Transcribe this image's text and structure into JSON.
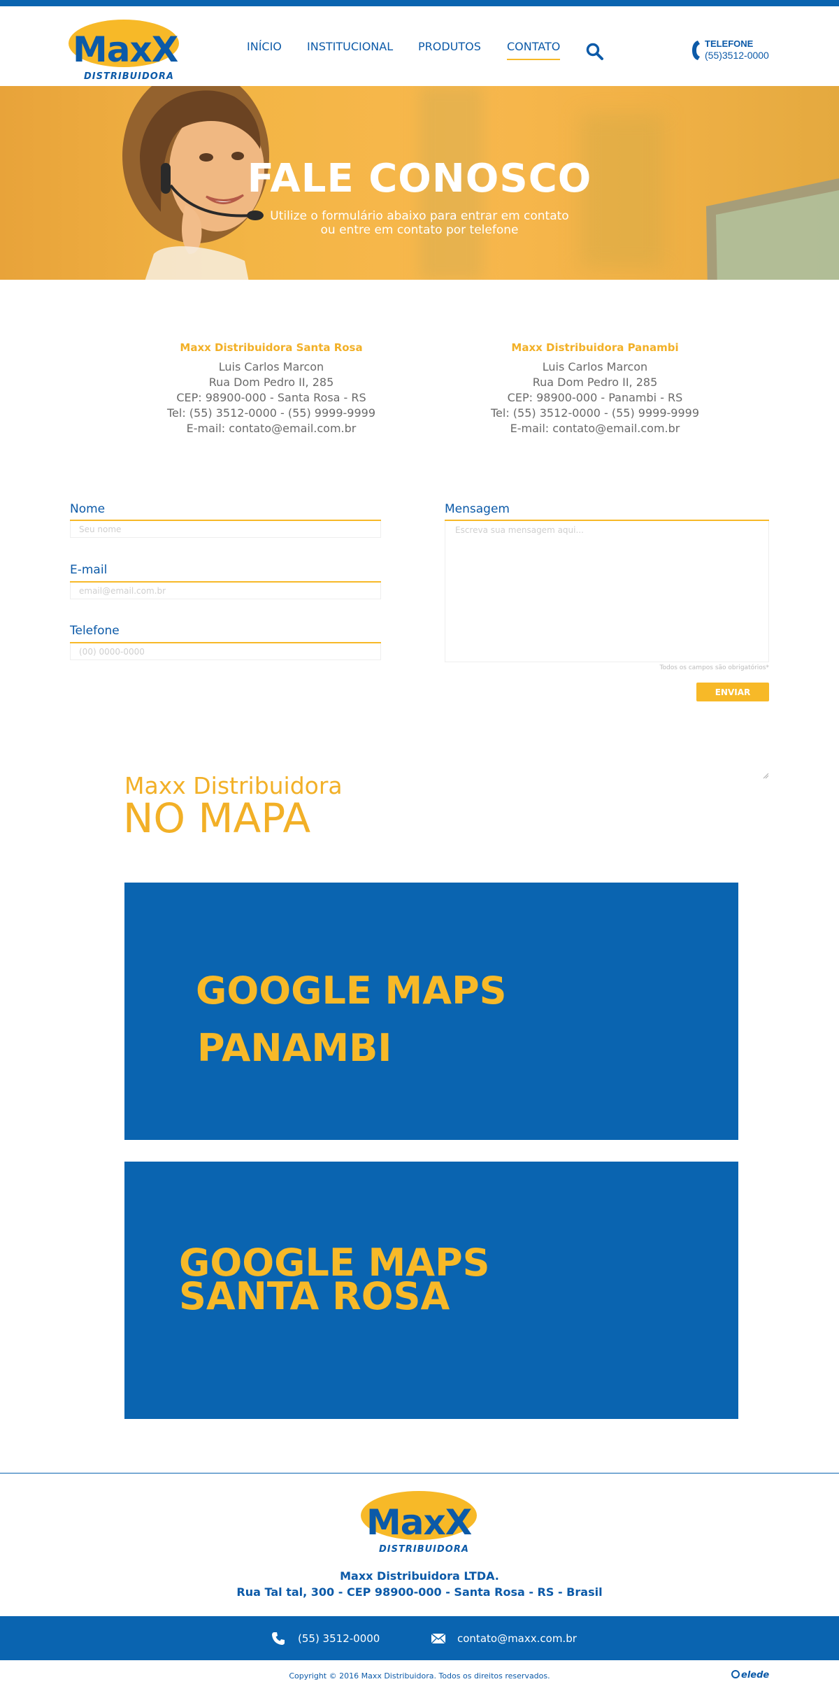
{
  "brand": {
    "logo_text": "MaxX",
    "logo_sub": "DISTRIBUIDORA",
    "colors": {
      "blue": "#0a64b0",
      "yellow": "#f7b928"
    }
  },
  "nav": {
    "items": [
      {
        "label": "INÍCIO",
        "active": false
      },
      {
        "label": "INSTITUCIONAL",
        "active": false
      },
      {
        "label": "PRODUTOS",
        "active": false
      },
      {
        "label": "CONTATO",
        "active": true
      }
    ],
    "search_icon": "search-icon"
  },
  "header_phone": {
    "label": "TELEFONE",
    "number": "(55)3512-0000",
    "icon": "phone-icon"
  },
  "hero": {
    "title": "FALE CONOSCO",
    "subtitle_line1": "Utilize o formulário abaixo para entrar em contato",
    "subtitle_line2": "ou entre em contato por telefone"
  },
  "contacts": [
    {
      "name": "Maxx Distribuidora Santa Rosa",
      "person": "Luis Carlos Marcon",
      "street": "Rua Dom Pedro II, 285",
      "cep": "CEP: 98900-000 - Santa Rosa - RS",
      "tel": "Tel: (55) 3512-0000 - (55) 9999-9999",
      "email": "E-mail: contato@email.com.br"
    },
    {
      "name": "Maxx Distribuidora Panambi",
      "person": "Luis Carlos Marcon",
      "street": "Rua Dom Pedro II, 285",
      "cep": "CEP: 98900-000 - Panambi - RS",
      "tel": "Tel: (55) 3512-0000 - (55) 9999-9999",
      "email": "E-mail: contato@email.com.br"
    }
  ],
  "form": {
    "name_label": "Nome",
    "name_placeholder": "Seu nome",
    "email_label": "E-mail",
    "email_placeholder": "email@email.com.br",
    "phone_label": "Telefone",
    "phone_placeholder": "(00) 0000-0000",
    "message_label": "Mensagem",
    "message_placeholder": "Escreva sua mensagem aqui...",
    "required_note": "Todos os campos são obrigatórios*",
    "submit_label": "ENVIAR"
  },
  "map_section": {
    "kicker": "Maxx Distribuidora",
    "title": "NO MAPA",
    "maps": [
      {
        "line1": "GOOGLE MAPS",
        "line2": "PANAMBI"
      },
      {
        "line1": "GOOGLE MAPS",
        "line2": "SANTA ROSA"
      }
    ]
  },
  "footer": {
    "company": "Maxx Distribuidora LTDA.",
    "address": "Rua Tal tal, 300 - CEP 98900-000 - Santa Rosa - RS - Brasil",
    "phone": "(55) 3512-0000",
    "email": "contato@maxx.com.br",
    "copyright": "Copyright © 2016 Maxx Distribuidora. Todos os direitos reservados.",
    "credit": "elede"
  }
}
